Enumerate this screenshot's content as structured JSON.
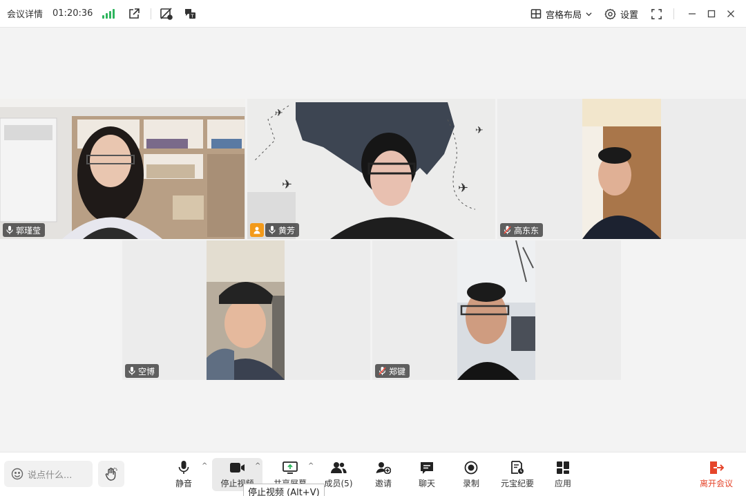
{
  "header": {
    "meeting_info": "会议详情",
    "timer": "01:20:36",
    "layout_label": "宫格布局",
    "settings_label": "设置"
  },
  "participants": [
    {
      "name": "郭瑾莹",
      "mic": "on",
      "host": false
    },
    {
      "name": "黄芳",
      "mic": "on",
      "host": true
    },
    {
      "name": "高东东",
      "mic": "muted",
      "host": false
    },
    {
      "name": "空博",
      "mic": "on",
      "host": false
    },
    {
      "name": "郑键",
      "mic": "muted",
      "host": false
    }
  ],
  "toolbar": {
    "chat_placeholder": "说点什么...",
    "mute_label": "静音",
    "video_label": "停止视频",
    "share_label": "共享屏幕",
    "members_label": "成员(5)",
    "invite_label": "邀请",
    "chat_label": "聊天",
    "record_label": "录制",
    "minutes_label": "元宝纪要",
    "apps_label": "应用",
    "leave_label": "离开会议"
  },
  "tooltip": "停止视频 (Alt+V)",
  "colors": {
    "accent_green": "#2db55d",
    "leave_red": "#e5452b",
    "host_orange": "#f39a1a"
  },
  "icons": [
    "signal-icon",
    "share-link-icon",
    "ai-off-icon",
    "translate-icon",
    "grid-icon",
    "chevron-down-icon",
    "gear-icon",
    "fullscreen-icon",
    "minimize-icon",
    "maximize-icon",
    "close-icon",
    "mic-icon",
    "mic-muted-icon",
    "host-icon",
    "emoji-icon",
    "hand-icon",
    "camera-icon",
    "screen-share-icon",
    "members-icon",
    "invite-icon",
    "chat-icon",
    "record-icon",
    "minutes-icon",
    "apps-icon",
    "leave-icon"
  ]
}
